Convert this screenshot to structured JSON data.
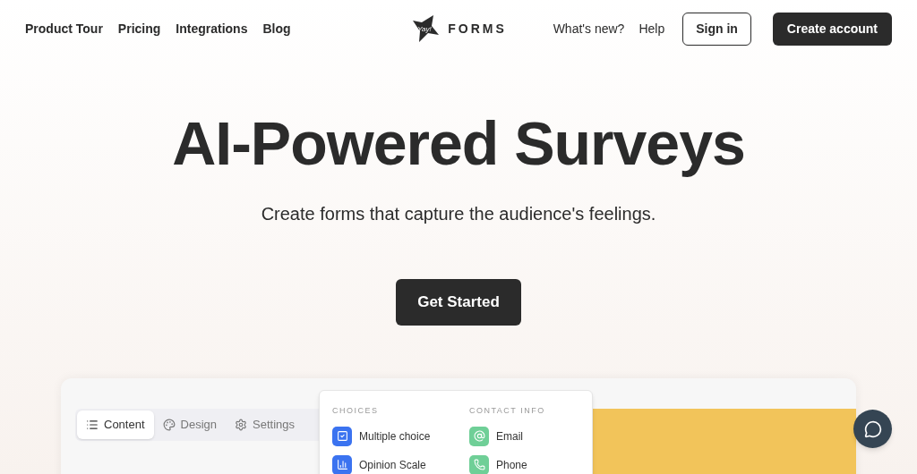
{
  "nav": {
    "links": [
      "Product Tour",
      "Pricing",
      "Integrations",
      "Blog"
    ],
    "logo": {
      "mark": "Yay!",
      "wordmark": "FORMS"
    },
    "right_links": [
      "What's new?",
      "Help"
    ],
    "sign_in": "Sign in",
    "create_account": "Create account"
  },
  "hero": {
    "title": "AI-Powered Surveys",
    "subtitle": "Create forms that capture the audience's feelings.",
    "cta": "Get Started"
  },
  "editor": {
    "tabs": [
      {
        "label": "Content",
        "kind": "list",
        "selected": true
      },
      {
        "label": "Design",
        "kind": "palette",
        "selected": false
      },
      {
        "label": "Settings",
        "kind": "gear",
        "selected": false
      }
    ],
    "menu": [
      {
        "heading": "CHOICES",
        "items": [
          {
            "label": "Multiple choice",
            "kind": "checkbox",
            "color": "#3b73f0"
          },
          {
            "label": "Opinion Scale",
            "kind": "bars",
            "color": "#3b73f0"
          }
        ]
      },
      {
        "heading": "CONTACT INFO",
        "items": [
          {
            "label": "Email",
            "kind": "at",
            "color": "#6fcf97"
          },
          {
            "label": "Phone",
            "kind": "phone",
            "color": "#6fcf97"
          }
        ]
      }
    ]
  }
}
